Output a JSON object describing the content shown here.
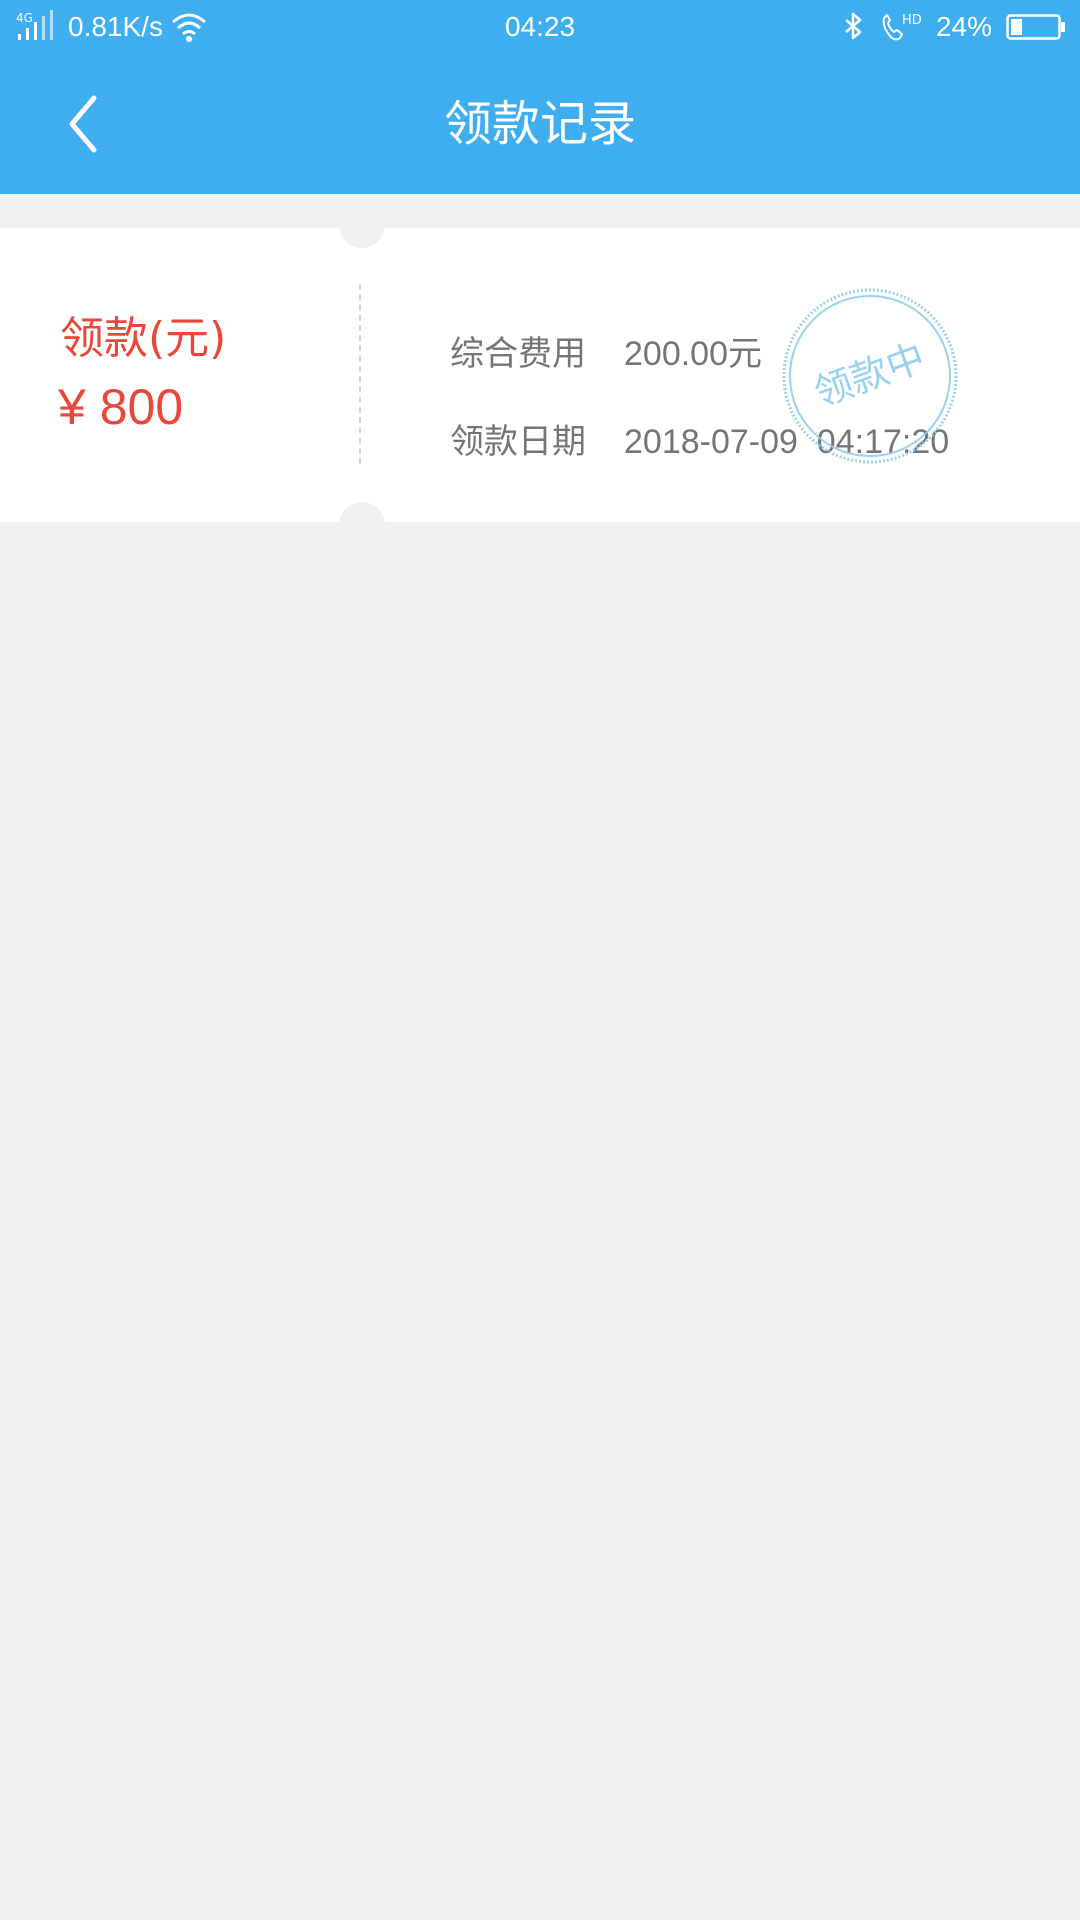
{
  "status_bar": {
    "network_type": "4G",
    "net_speed": "0.81K/s",
    "time": "04:23",
    "call_badge": "HD",
    "battery": "24%",
    "icons": [
      "signal-icon",
      "wifi-icon",
      "bluetooth-icon",
      "hd-call-icon",
      "battery-icon"
    ],
    "battery_level": 0.24
  },
  "header": {
    "title": "领款记录",
    "back_icon": "chevron-left-icon"
  },
  "record": {
    "amount_label": "领款(元)",
    "amount_value": "¥ 800",
    "fee_label": "综合费用",
    "fee_value": "200.00元",
    "date_label": "领款日期",
    "date_value": "2018-07-09  04:17:20",
    "stamp_text": "领款中"
  },
  "colors": {
    "primary": "#3eaef0",
    "amount": "#e8483a",
    "text_secondary": "#757575",
    "stamp": "#8fcdef",
    "background": "#f0f2f2"
  }
}
